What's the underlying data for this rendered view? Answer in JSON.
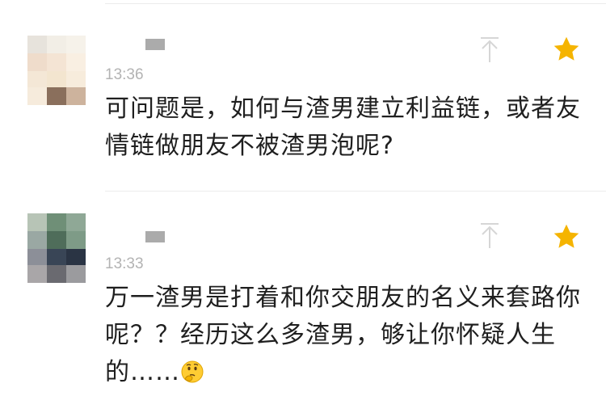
{
  "comments": [
    {
      "time": "13:36",
      "text": "可问题是，如何与渣男建立利益链，或者友情链做朋友不被渣男泡呢?",
      "accent": "#f5b400"
    },
    {
      "time": "13:33",
      "text": "万一渣男是打着和你交朋友的名义来套路你呢？？经历这么多渣男，够让你怀疑人生的……",
      "emoji": "thinking-face",
      "accent": "#f5b400"
    }
  ],
  "icons": {
    "like": "thumb-up-arrow-icon",
    "star": "star-icon"
  }
}
